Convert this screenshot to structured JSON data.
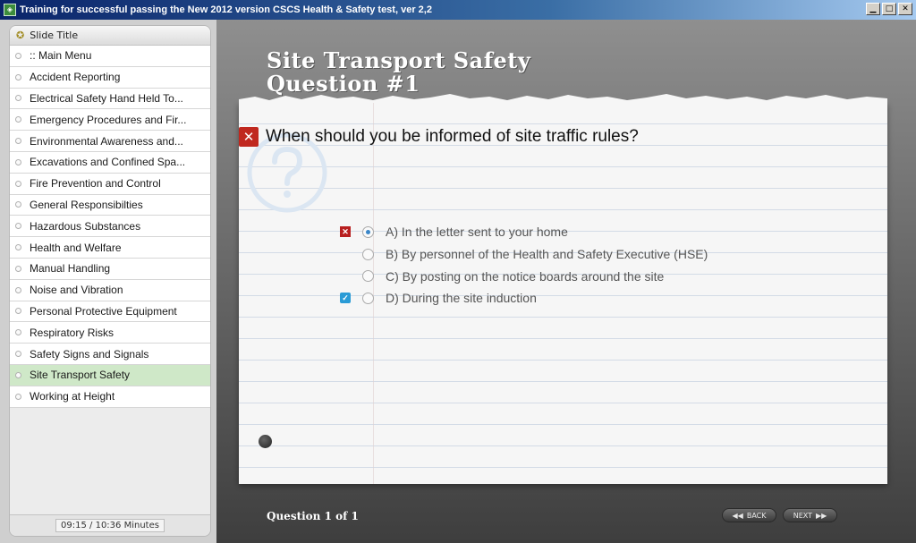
{
  "window": {
    "title": "Training for successful passing the New 2012 version CSCS Health & Safety test, ver 2,2",
    "buttons": [
      "minimize-icon",
      "maximize-icon",
      "close-icon"
    ]
  },
  "sidebar": {
    "header": "Slide Title",
    "items": [
      {
        "label": ":: Main Menu"
      },
      {
        "label": "Accident Reporting"
      },
      {
        "label": "Electrical Safety Hand Held To..."
      },
      {
        "label": "Emergency Procedures and Fir..."
      },
      {
        "label": "Environmental Awareness and..."
      },
      {
        "label": "Excavations and Confined Spa..."
      },
      {
        "label": "Fire Prevention and Control"
      },
      {
        "label": "General Responsibilties"
      },
      {
        "label": "Hazardous Substances"
      },
      {
        "label": "Health and Welfare"
      },
      {
        "label": "Manual Handling"
      },
      {
        "label": "Noise and Vibration"
      },
      {
        "label": "Personal Protective Equipment"
      },
      {
        "label": "Respiratory Risks"
      },
      {
        "label": "Safety Signs and Signals"
      },
      {
        "label": "Site Transport Safety",
        "active": true
      },
      {
        "label": "Working at Height"
      }
    ],
    "timer": "09:15 / 10:36 Minutes"
  },
  "slide": {
    "title_line1": "Site Transport Safety",
    "title_line2": "Question #1",
    "question": "When should you be informed of site traffic rules?",
    "answers": [
      {
        "label": "A) In the letter sent to your home",
        "selected": true,
        "result": "wrong"
      },
      {
        "label": "B) By personnel of the Health and Safety Executive (HSE)",
        "selected": false,
        "result": "none"
      },
      {
        "label": "C) By posting on the notice boards around the site",
        "selected": false,
        "result": "none"
      },
      {
        "label": "D) During the site induction",
        "selected": false,
        "result": "correct"
      }
    ],
    "counter": "Question 1 of 1",
    "back_label": "BACK",
    "next_label": "NEXT"
  },
  "colors": {
    "wrong": "#c0281f",
    "correct": "#2a9bd6",
    "active_menu": "#cfe8c8"
  }
}
